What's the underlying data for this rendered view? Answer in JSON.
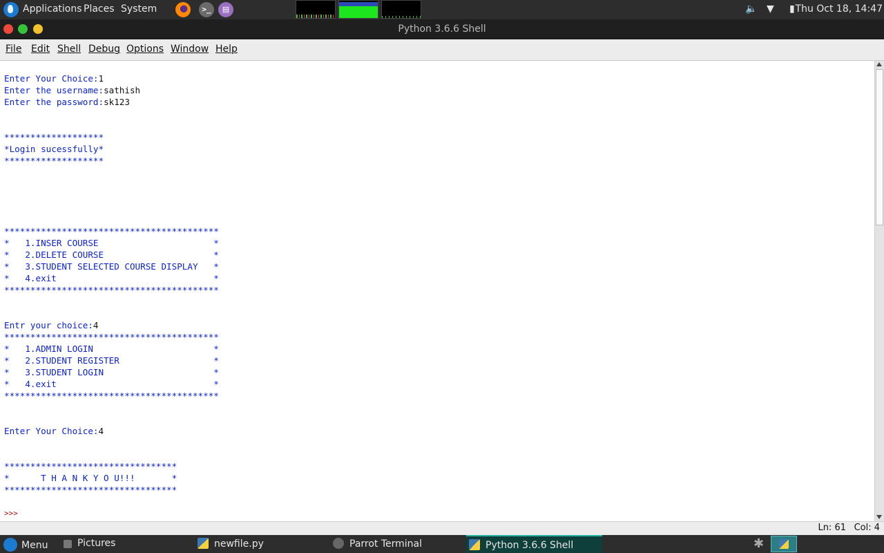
{
  "top_panel": {
    "applications": "Applications",
    "places": "Places",
    "system": "System",
    "clock": "Thu Oct 18, 14:47"
  },
  "window": {
    "title": "Python 3.6.6 Shell"
  },
  "menubar": {
    "file": "File",
    "edit": "Edit",
    "shell": "Shell",
    "debug": "Debug",
    "options": "Options",
    "window": "Window",
    "help": "Help"
  },
  "shell": {
    "lines": [
      "Enter Your Choice:|1",
      "Enter the username:|sathish",
      "Enter the password:|sk123",
      "",
      "",
      "*******************",
      "*Login sucessfully*",
      "*******************",
      "",
      "",
      "",
      "",
      "",
      "*****************************************",
      "*   1.INSER COURSE                      *",
      "*   2.DELETE COURSE                     *",
      "*   3.STUDENT SELECTED COURSE DISPLAY   *",
      "*   4.exit                              *",
      "*****************************************",
      "",
      "",
      "Entr your choice:|4",
      "*****************************************",
      "*   1.ADMIN LOGIN                       *",
      "*   2.STUDENT REGISTER                  *",
      "*   3.STUDENT LOGIN                     *",
      "*   4.exit                              *",
      "*****************************************",
      "",
      "",
      "Enter Your Choice:|4",
      "",
      "",
      "*********************************",
      "*      T H A N K Y O U!!!       *",
      "*********************************"
    ],
    "prompt": ">>>"
  },
  "statusbar": {
    "ln": "Ln: 61",
    "col": "Col: 4"
  },
  "taskbar": {
    "menu": "Menu",
    "pictures": "Pictures",
    "newfile": "newfile.py",
    "terminal": "Parrot Terminal",
    "python_shell": "Python 3.6.6 Shell"
  },
  "icons": {
    "apps_logo": "parrot-logo-icon",
    "firefox": "firefox-icon",
    "terminal": "terminal-icon",
    "editor": "text-editor-icon",
    "volume": "volume-icon",
    "wifi": "wifi-icon",
    "battery": "battery-icon"
  },
  "colors": {
    "shell_output": "#0b22d8",
    "shell_input": "#111111",
    "prompt": "#b01010",
    "panel_bg": "#2d2d2d",
    "active_task": "#0f3f3b"
  },
  "system_monitor": {
    "mem_fill_fraction": 0.7
  }
}
